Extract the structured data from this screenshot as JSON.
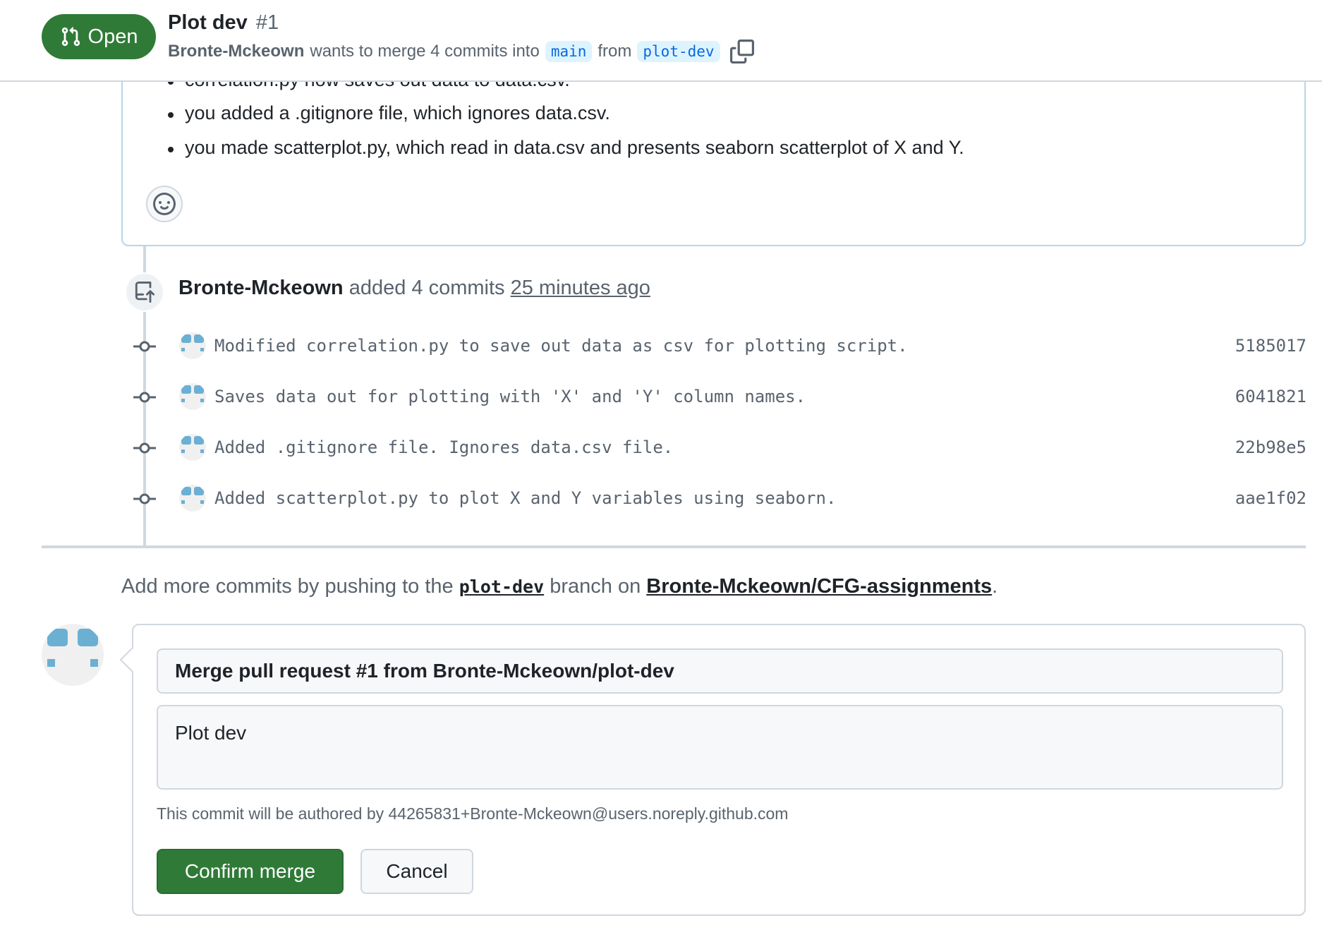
{
  "header": {
    "state_label": "Open",
    "title": "Plot dev",
    "number": "#1",
    "author": "Bronte-Mckeown",
    "merge_text_1": "wants to merge 4 commits into",
    "base_branch": "main",
    "merge_text_2": "from",
    "head_branch": "plot-dev",
    "copy_icon": "copy-icon"
  },
  "description": {
    "bullets": [
      "correlation.py now saves out data to data.csv.",
      "you added a .gitignore file, which ignores data.csv.",
      "you made scatterplot.py, which read in data.csv and presents seaborn scatterplot of X and Y."
    ],
    "reaction_icon": "smiley-icon"
  },
  "timeline": {
    "push_event": {
      "author": "Bronte-Mckeown",
      "action": "added 4 commits",
      "time": "25 minutes ago",
      "icon": "repo-push-icon"
    },
    "commits": [
      {
        "message": "Modified correlation.py to save out data as csv for plotting script.",
        "sha": "5185017"
      },
      {
        "message": "Saves data out for plotting with 'X' and 'Y' column names.",
        "sha": "6041821"
      },
      {
        "message": "Added .gitignore file. Ignores data.csv file.",
        "sha": "22b98e5"
      },
      {
        "message": "Added scatterplot.py to plot X and Y variables using seaborn.",
        "sha": "aae1f02"
      }
    ]
  },
  "hint": {
    "prefix": "Add more commits by pushing to the",
    "branch": "plot-dev",
    "middle": "branch on",
    "repo": "Bronte-Mckeown/CFG-assignments",
    "suffix": "."
  },
  "merge": {
    "title_value": "Merge pull request #1 from Bronte-Mckeown/plot-dev",
    "body_value": "Plot dev",
    "author_note": "This commit will be authored by 44265831+Bronte-Mckeown@users.noreply.github.com",
    "confirm_label": "Confirm merge",
    "cancel_label": "Cancel"
  },
  "colors": {
    "open_green": "#2f7a37",
    "branch_blue": "#0969da",
    "branch_bg": "#ddf4ff",
    "avatar_blue": "#6bb0d3"
  }
}
